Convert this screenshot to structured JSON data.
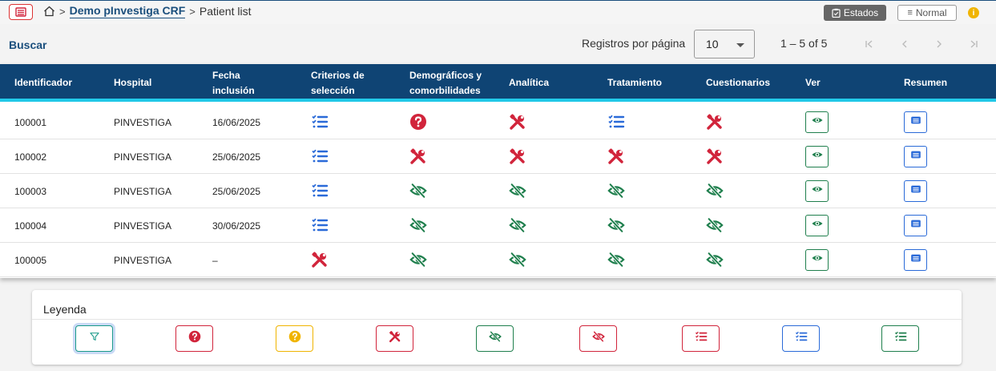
{
  "colors": {
    "header_bg": "#0f4474",
    "accent_line": "#21c9e8",
    "red": "#d1243b",
    "blue": "#2a6ad8",
    "green": "#1f7f4d",
    "yellow": "#f0b400",
    "link": "#1b4f7d"
  },
  "topbar": {
    "menu_icon": "list-icon",
    "breadcrumb": {
      "home_icon": "home-icon",
      "project": "Demo pInvestiga CRF",
      "current": "Patient list"
    },
    "estados_label": "Estados",
    "normal_label": "Normal",
    "info_icon": "info-icon"
  },
  "toolbar": {
    "search_label": "Buscar",
    "rows_per_page_label": "Registros por página",
    "rows_per_page_value": "10",
    "range_text": "1 – 5 of 5"
  },
  "table": {
    "columns": [
      "Identificador",
      "Hospital",
      "Fecha inclusión",
      "Criterios de selección",
      "Demográficos y comorbilidades",
      "Analítica",
      "Tratamiento",
      "Cuestionarios",
      "Ver",
      "Resumen"
    ],
    "rows": [
      {
        "id": "100001",
        "hospital": "PINVESTIGA",
        "date": "16/06/2025",
        "status": [
          "list-blue",
          "question-red",
          "tools-red",
          "list-blue",
          "tools-red"
        ]
      },
      {
        "id": "100002",
        "hospital": "PINVESTIGA",
        "date": "25/06/2025",
        "status": [
          "list-blue",
          "tools-red",
          "tools-red",
          "tools-red",
          "tools-red"
        ]
      },
      {
        "id": "100003",
        "hospital": "PINVESTIGA",
        "date": "25/06/2025",
        "status": [
          "list-blue",
          "eye-slash-green",
          "eye-slash-green",
          "eye-slash-green",
          "eye-slash-green"
        ]
      },
      {
        "id": "100004",
        "hospital": "PINVESTIGA",
        "date": "30/06/2025",
        "status": [
          "list-blue",
          "eye-slash-green",
          "eye-slash-green",
          "eye-slash-green",
          "eye-slash-green"
        ]
      },
      {
        "id": "100005",
        "hospital": "PINVESTIGA",
        "date": "–",
        "status": [
          "tools-red",
          "eye-slash-green",
          "eye-slash-green",
          "eye-slash-green",
          "eye-slash-green"
        ]
      }
    ]
  },
  "legend": {
    "title": "Leyenda",
    "items": [
      "filter-teal",
      "question-red",
      "question-yellow",
      "tools-red",
      "eye-slash-green",
      "eye-slash-red",
      "list-red",
      "list-blue",
      "list-green"
    ]
  }
}
